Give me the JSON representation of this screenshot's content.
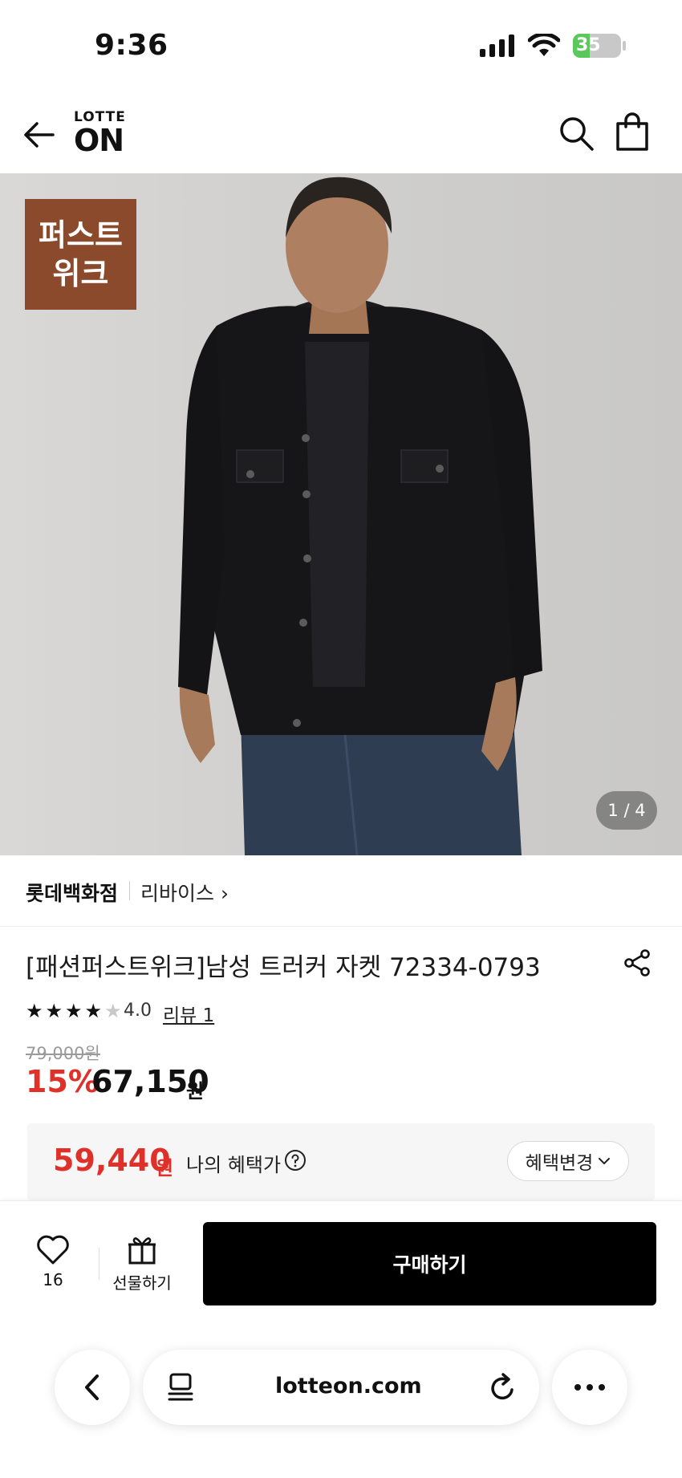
{
  "status_bar": {
    "time": "9:36",
    "battery": "35",
    "battery_level": 0.35
  },
  "header": {
    "logo_small": "LOTTE",
    "logo_big": "ON"
  },
  "hero": {
    "badge_line1": "퍼스트",
    "badge_line2": "위크",
    "pager": "1 / 4"
  },
  "seller": {
    "store": "롯데백화점",
    "brand": "리바이스 ›"
  },
  "product": {
    "title": "[패션퍼스트위크]남성 트러커 자켓 72334-0793",
    "rating_value": 4,
    "rating": "4.0",
    "review": "리뷰 1",
    "original_price": "79,000원",
    "discount": "15%",
    "price": "67,150",
    "price_unit": "원"
  },
  "benefit": {
    "price": "59,440",
    "unit": "원",
    "label": "나의 혜택가",
    "button": "혜택변경"
  },
  "action_bar": {
    "wish_count": "16",
    "gift_label": "선물하기",
    "buy_label": "구매하기"
  },
  "browser": {
    "url": "lotteon.com"
  },
  "colors": {
    "accent_red": "#e0302a",
    "badge_brown": "#8b4a2b",
    "battery_green": "#5ac85a"
  }
}
